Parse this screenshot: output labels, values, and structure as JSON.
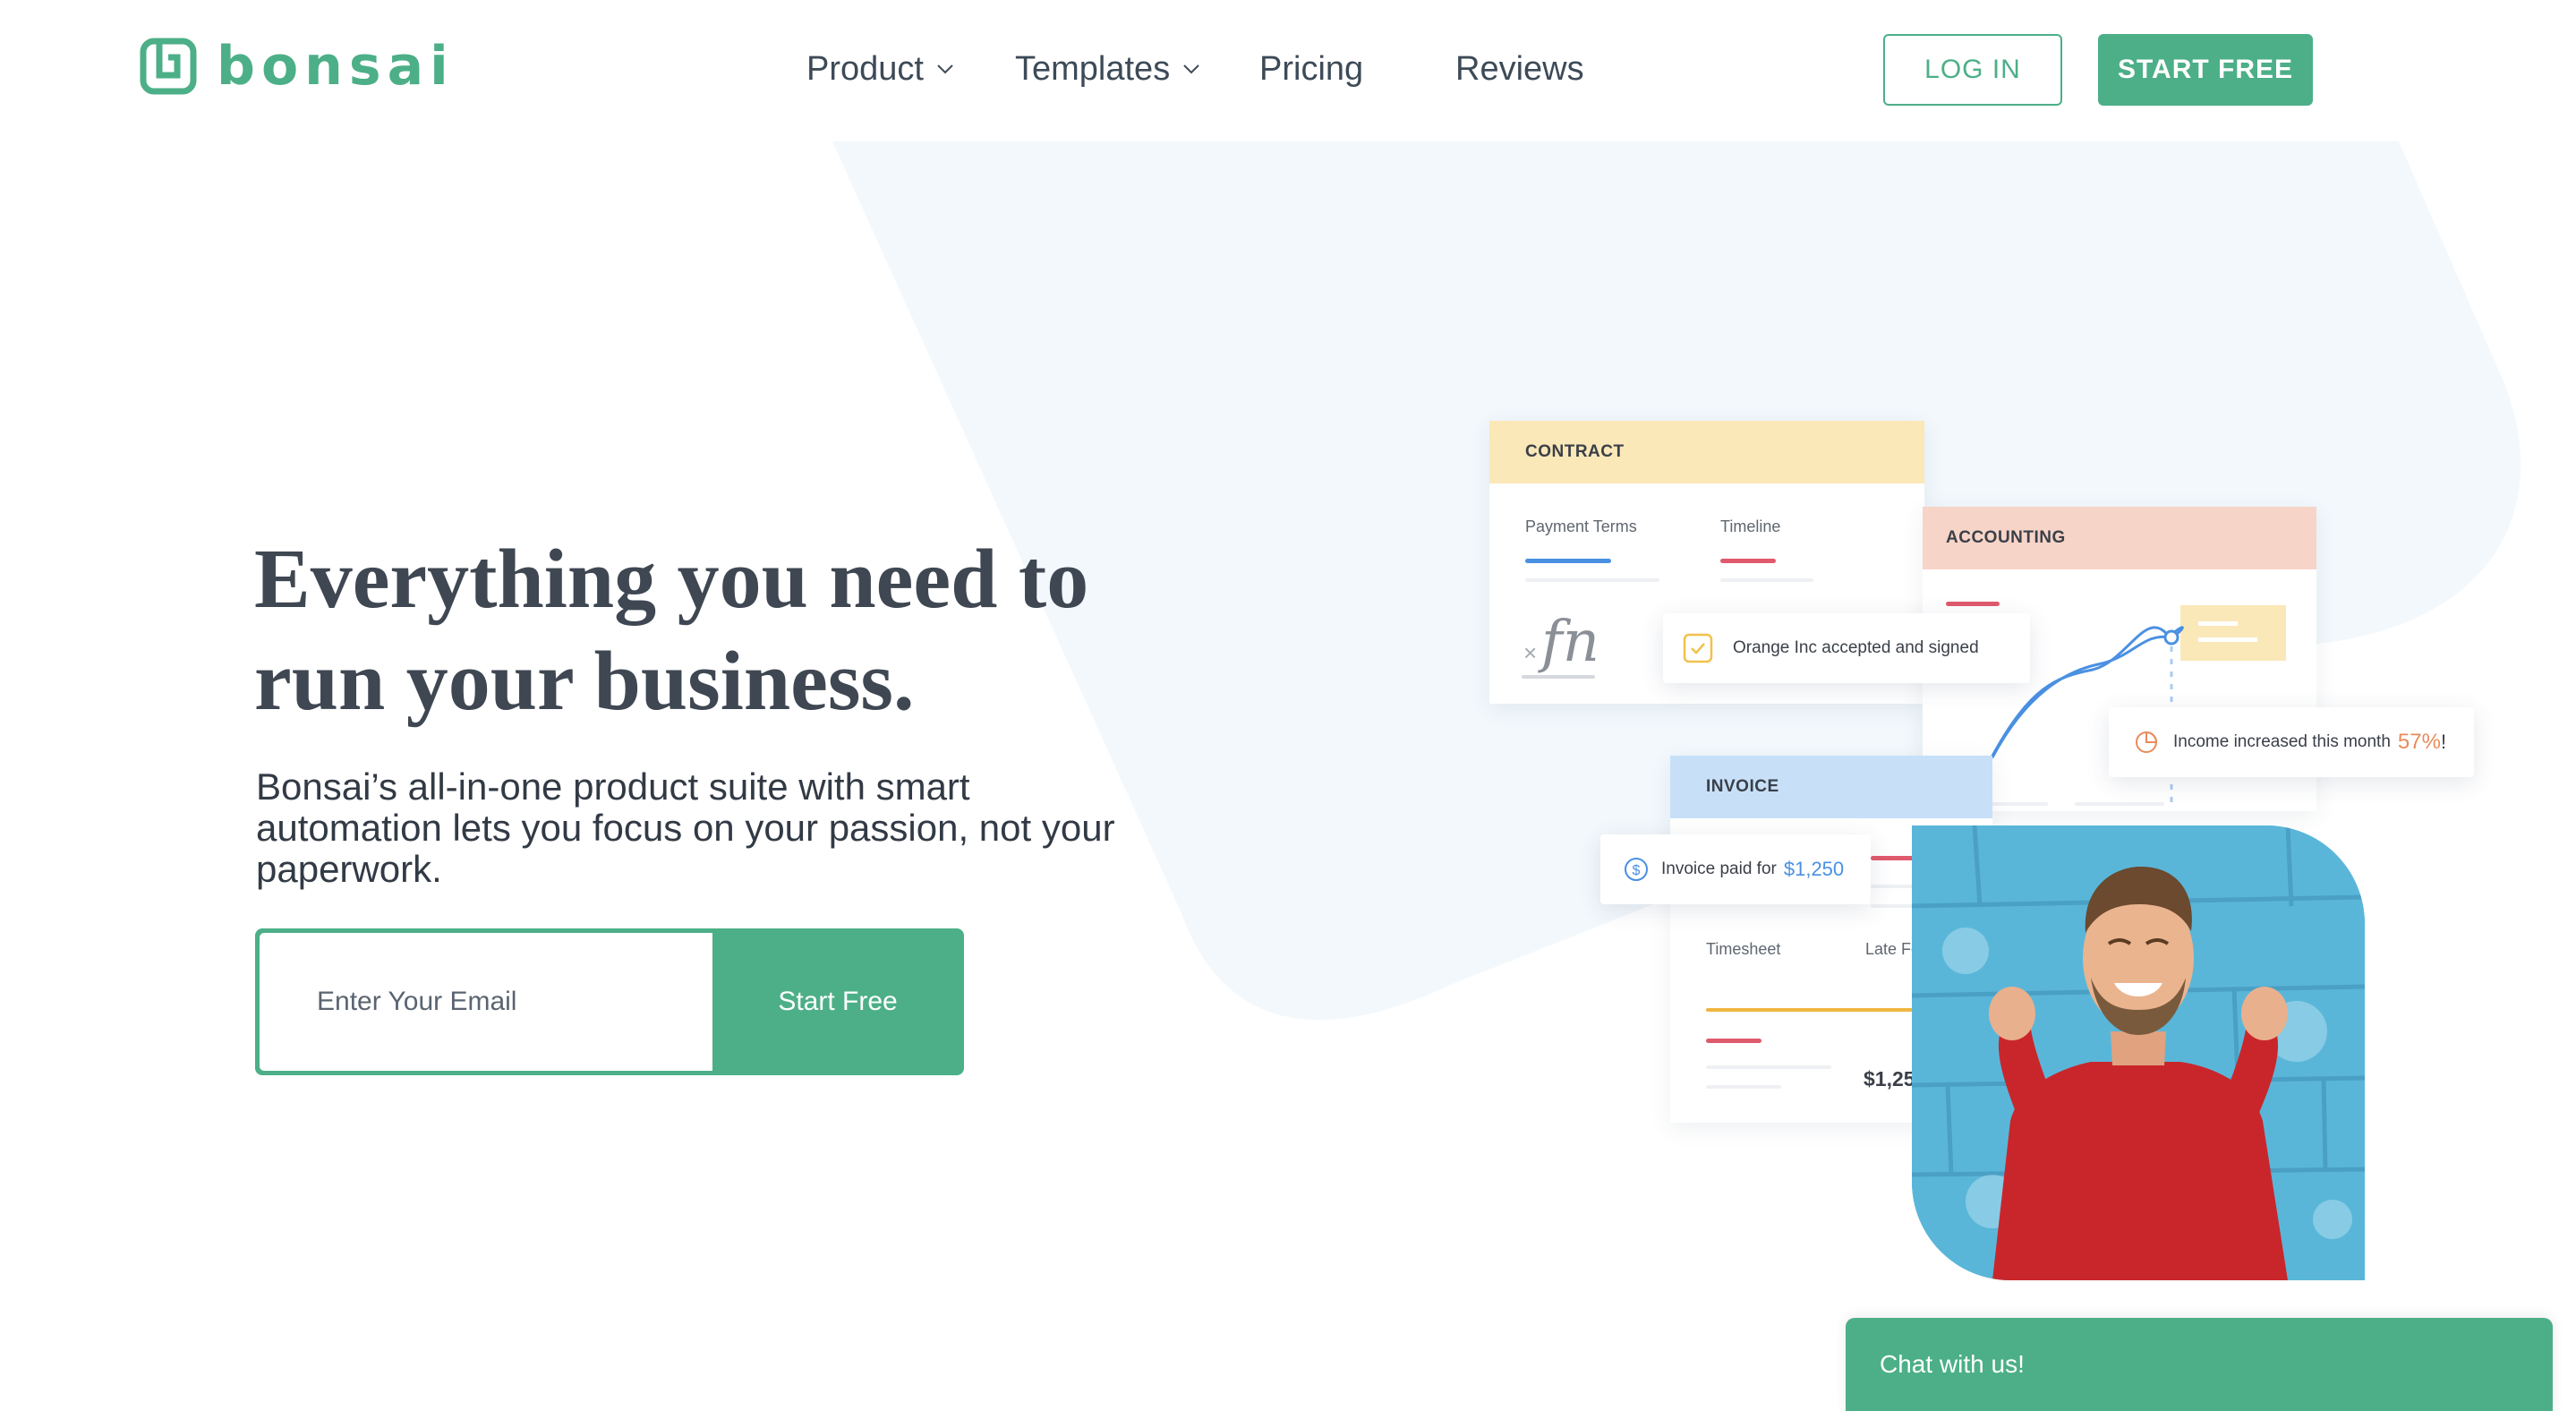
{
  "brand": {
    "name": "bonsai",
    "color": "#4caf87",
    "logo_icon": "bonsai-logo-icon"
  },
  "nav": {
    "items": [
      {
        "label": "Product",
        "has_dropdown": true
      },
      {
        "label": "Templates",
        "has_dropdown": true
      },
      {
        "label": "Pricing",
        "has_dropdown": false
      },
      {
        "label": "Reviews",
        "has_dropdown": false
      }
    ],
    "login_label": "LOG IN",
    "start_label": "START FREE"
  },
  "hero": {
    "title": "Everything you need to run your business.",
    "subtitle": "Bonsai’s all-in-one product suite with smart automation lets you focus on your passion, not your paperwork.",
    "email_placeholder": "Enter Your Email",
    "cta_label": "Start Free"
  },
  "illustration": {
    "contract": {
      "title": "CONTRACT",
      "col1": "Payment Terms",
      "col2": "Timeline",
      "signature_prefix": "×",
      "signature_text": "fn"
    },
    "accounting": {
      "title": "ACCOUNTING"
    },
    "invoice": {
      "title": "INVOICE",
      "col1": "Timesheet",
      "col2": "Late Fees",
      "total": "$1,254.00"
    },
    "toast_signed": "Orange Inc accepted and signed",
    "toast_income_text": "Income increased this month",
    "toast_income_value": "57%",
    "toast_income_suffix": "!",
    "toast_invoice_text": "Invoice paid for",
    "toast_invoice_value": "$1,250",
    "colors": {
      "contract": "#fbe8b8",
      "accounting": "#f7d4c8",
      "invoice": "#c7e0f8",
      "accent_blue": "#4a90e2",
      "accent_red": "#e05a6d",
      "accent_orange": "#e98b5b"
    }
  },
  "chat": {
    "label": "Chat with us!"
  }
}
